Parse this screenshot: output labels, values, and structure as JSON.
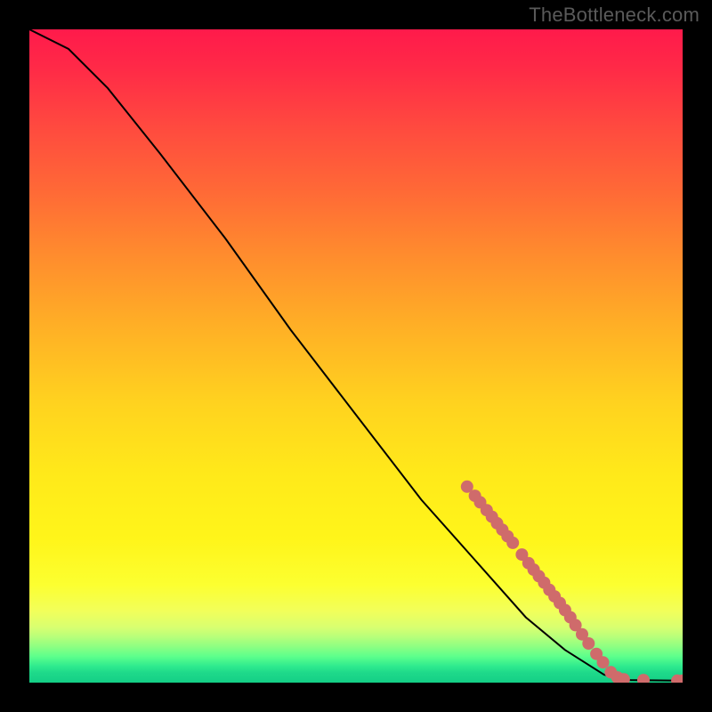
{
  "watermark": "TheBottleneck.com",
  "chart_data": {
    "type": "line",
    "title": "",
    "xlabel": "",
    "ylabel": "",
    "xlim": [
      0,
      100
    ],
    "ylim": [
      0,
      100
    ],
    "curve": [
      {
        "x": 0,
        "y": 100
      },
      {
        "x": 6,
        "y": 97
      },
      {
        "x": 12,
        "y": 91
      },
      {
        "x": 20,
        "y": 81
      },
      {
        "x": 30,
        "y": 68
      },
      {
        "x": 40,
        "y": 54
      },
      {
        "x": 50,
        "y": 41
      },
      {
        "x": 60,
        "y": 28
      },
      {
        "x": 68,
        "y": 19
      },
      {
        "x": 76,
        "y": 10
      },
      {
        "x": 82,
        "y": 5
      },
      {
        "x": 88,
        "y": 1.2
      },
      {
        "x": 92,
        "y": 0.4
      },
      {
        "x": 100,
        "y": 0.3
      }
    ],
    "points": [
      {
        "x": 67.0,
        "y": 30.0
      },
      {
        "x": 68.2,
        "y": 28.6
      },
      {
        "x": 69.0,
        "y": 27.6
      },
      {
        "x": 70.0,
        "y": 26.4
      },
      {
        "x": 70.8,
        "y": 25.4
      },
      {
        "x": 71.6,
        "y": 24.4
      },
      {
        "x": 72.4,
        "y": 23.4
      },
      {
        "x": 73.2,
        "y": 22.4
      },
      {
        "x": 74.0,
        "y": 21.4
      },
      {
        "x": 75.4,
        "y": 19.6
      },
      {
        "x": 76.4,
        "y": 18.3
      },
      {
        "x": 77.2,
        "y": 17.3
      },
      {
        "x": 78.0,
        "y": 16.3
      },
      {
        "x": 78.8,
        "y": 15.3
      },
      {
        "x": 79.6,
        "y": 14.2
      },
      {
        "x": 80.4,
        "y": 13.2
      },
      {
        "x": 81.2,
        "y": 12.2
      },
      {
        "x": 82.0,
        "y": 11.1
      },
      {
        "x": 82.8,
        "y": 10.0
      },
      {
        "x": 83.6,
        "y": 8.8
      },
      {
        "x": 84.6,
        "y": 7.4
      },
      {
        "x": 85.6,
        "y": 6.0
      },
      {
        "x": 86.8,
        "y": 4.4
      },
      {
        "x": 87.8,
        "y": 3.1
      },
      {
        "x": 89.0,
        "y": 1.6
      },
      {
        "x": 90.0,
        "y": 0.8
      },
      {
        "x": 91.0,
        "y": 0.5
      },
      {
        "x": 94.0,
        "y": 0.4
      },
      {
        "x": 99.2,
        "y": 0.3
      },
      {
        "x": 100.0,
        "y": 0.3
      }
    ],
    "colors": {
      "line": "#000000",
      "point_fill": "#cf6b6b",
      "point_stroke": "#a84e4e"
    }
  }
}
